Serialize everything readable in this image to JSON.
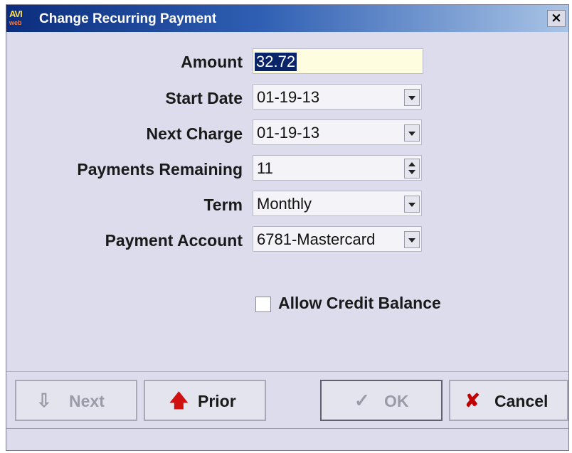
{
  "window": {
    "logo_top": "AVI",
    "logo_bottom": "web",
    "title": "Change Recurring Payment",
    "close_symbol": "×"
  },
  "form": {
    "amount": {
      "label": "Amount",
      "value": "32.72"
    },
    "start_date": {
      "label": "Start Date",
      "value": "01-19-13"
    },
    "next_charge": {
      "label": "Next Charge",
      "value": "01-19-13"
    },
    "payments_remaining": {
      "label": "Payments Remaining",
      "value": "11"
    },
    "term": {
      "label": "Term",
      "value": "Monthly"
    },
    "payment_account": {
      "label": "Payment Account",
      "value": "6781-Mastercard"
    },
    "allow_credit_balance": {
      "label": "Allow Credit Balance",
      "checked": false
    }
  },
  "buttons": {
    "next": {
      "label": "Next",
      "icon": "⇩",
      "enabled": false
    },
    "prior": {
      "label": "Prior",
      "icon": "🡅",
      "enabled": true
    },
    "ok": {
      "label": "OK",
      "icon": "✓",
      "enabled": false
    },
    "cancel": {
      "label": "Cancel",
      "icon": "✘",
      "enabled": true
    }
  },
  "colors": {
    "title_gradient_start": "#0b2d7d",
    "window_bg": "#dcdcec",
    "amount_field_bg": "#fffde0",
    "selection_bg": "#0a246a",
    "prior_arrow": "#d01010",
    "cancel_x": "#c00000"
  },
  "status": {
    "text": ""
  }
}
